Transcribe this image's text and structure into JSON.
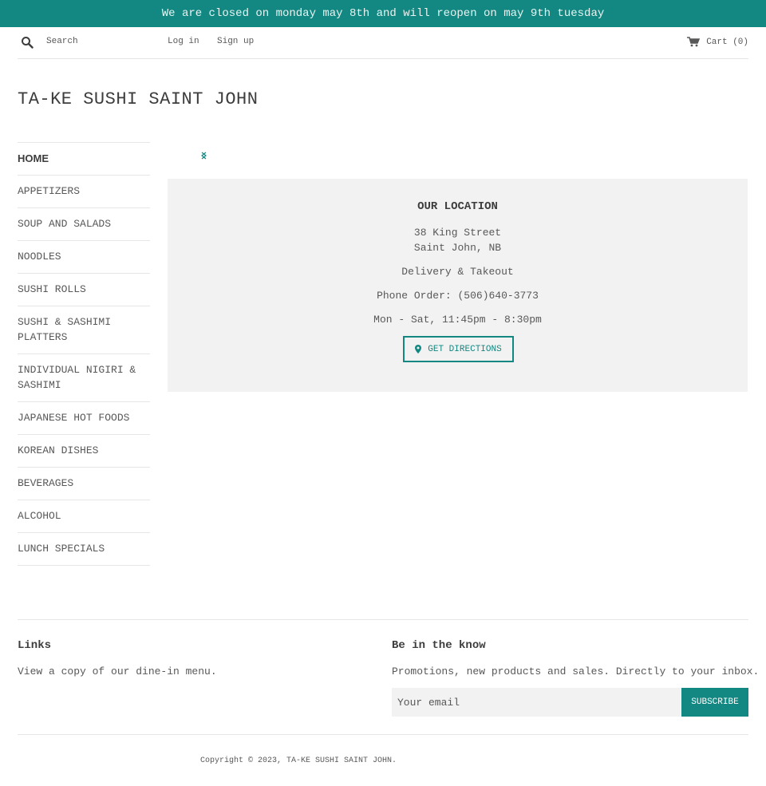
{
  "announcement": {
    "text": "We are closed on monday may 8th and will reopen on may 9th tuesday"
  },
  "header": {
    "search": {
      "placeholder": "Search",
      "icon": "search-icon"
    },
    "login_label": "Log in",
    "signup_label": "Sign up",
    "cart_label": "Cart (0)",
    "cart_icon": "cart-icon"
  },
  "site": {
    "title": "TA-KE SUSHI SAINT JOHN"
  },
  "sidebar": {
    "items": [
      {
        "label": "HOME",
        "active": true
      },
      {
        "label": "APPETIZERS"
      },
      {
        "label": "SOUP AND SALADS"
      },
      {
        "label": "NOODLES"
      },
      {
        "label": "SUSHI ROLLS"
      },
      {
        "label": "SUSHI & SASHIMI PLATTERS"
      },
      {
        "label": "INDIVIDUAL NIGIRI & SASHIMI"
      },
      {
        "label": "JAPANESE HOT FOODS"
      },
      {
        "label": "KOREAN DISHES"
      },
      {
        "label": "BEVERAGES"
      },
      {
        "label": "ALCOHOL"
      },
      {
        "label": "LUNCH SPECIALS"
      }
    ]
  },
  "main": {
    "broken_image_icon": "broken-image-icon",
    "location": {
      "title": "OUR LOCATION",
      "address_line1": "38 King Street",
      "address_line2": "Saint John, NB",
      "service": "Delivery & Takeout",
      "phone": "Phone Order: (506)640-3773",
      "hours": "Mon - Sat, 11:45pm - 8:30pm",
      "directions_label": "GET DIRECTIONS",
      "directions_icon": "map-pin-icon"
    }
  },
  "footer": {
    "links_heading": "Links",
    "links_text": "View a copy of our dine-in menu.",
    "newsletter_heading": "Be in the know",
    "newsletter_text": "Promotions, new products and sales. Directly to your inbox.",
    "email_placeholder": "Your email",
    "subscribe_label": "SUBSCRIBE",
    "copyright": "Copyright © 2023, TA-KE SUSHI SAINT JOHN."
  },
  "colors": {
    "accent": "#138781",
    "panel": "#f2f2f2",
    "text": "#585858",
    "heading": "#3d3d3d"
  }
}
